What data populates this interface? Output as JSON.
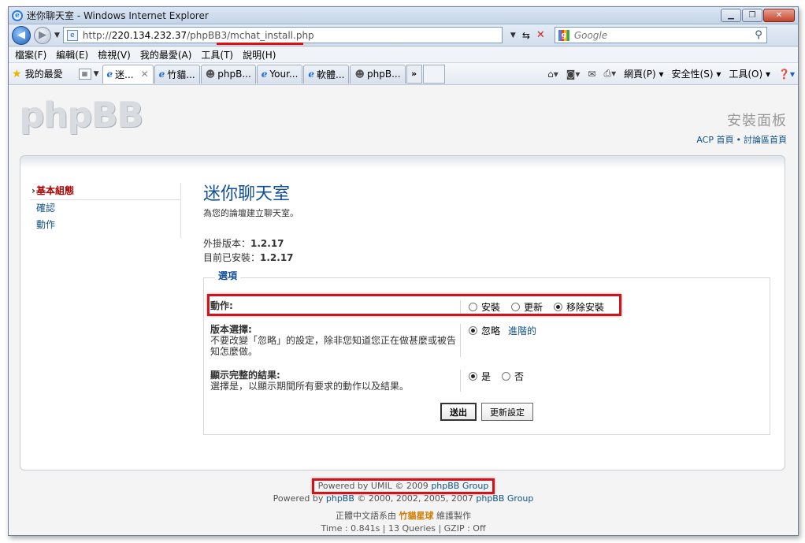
{
  "window": {
    "title": "迷你聊天室 - Windows Internet Explorer",
    "minimize": "▁",
    "restore": "❐",
    "close": "✕"
  },
  "address": {
    "url_prefix": "http://",
    "url_host": "220.134.232.37",
    "url_path": "/phpBB3/mchat_install.php",
    "search_placeholder": "Google"
  },
  "menu": [
    "檔案(F)",
    "編輯(E)",
    "檢視(V)",
    "我的最愛(A)",
    "工具(T)",
    "說明(H)"
  ],
  "favorites": {
    "label": "我的最愛",
    "tabs": [
      {
        "label": "迷...",
        "icon": "ie-icon",
        "active": true
      },
      {
        "label": "竹貓...",
        "icon": "ie-icon"
      },
      {
        "label": "phpB...",
        "icon": "people-icon"
      },
      {
        "label": "Your...",
        "icon": "ie-icon"
      },
      {
        "label": "軟體...",
        "icon": "ie-icon"
      },
      {
        "label": "phpB...",
        "icon": "people-icon"
      }
    ],
    "more": "»"
  },
  "commands": {
    "page": "網頁(P)",
    "safety": "安全性(S)",
    "tools": "工具(O)"
  },
  "header": {
    "logo": "phpBB",
    "panel_title": "安裝面板",
    "link_acp": "ACP 首頁",
    "link_forum": "討論區首頁"
  },
  "sidebar": {
    "items": [
      {
        "label": "基本組態",
        "active": true
      },
      {
        "label": "確認"
      },
      {
        "label": "動作"
      }
    ]
  },
  "main": {
    "title": "迷你聊天室",
    "description": "為您的論壇建立聊天室。",
    "mod_version_label": "外掛版本：",
    "mod_version": "1.2.17",
    "installed_label": "目前已安裝：",
    "installed_version": "1.2.17",
    "options_legend": "選項",
    "action": {
      "label": "動作:",
      "options": [
        "安裝",
        "更新",
        "移除安裝"
      ],
      "selected": 2
    },
    "version_select": {
      "label": "版本選擇:",
      "help": "不要改變「忽略」的設定，除非您知道您正在做甚麼或被告知怎麼做。",
      "options": [
        "忽略",
        "進階的"
      ],
      "selected": 0
    },
    "show_results": {
      "label": "顯示完整的結果:",
      "help": "選擇是，以顯示期間所有要求的動作以及結果。",
      "options": [
        "是",
        "否"
      ],
      "selected": 0
    },
    "submit": "送出",
    "reset": "更新設定"
  },
  "footer": {
    "umil_prefix": "Powered by UMIL © 2009",
    "umil_link": "phpBB Group",
    "phpbb_prefix": "Powered by",
    "phpbb_link1": "phpBB",
    "phpbb_mid": "© 2000, 2002, 2005, 2007",
    "phpbb_link2": "phpBB Group",
    "translation_prefix": "正體中文語系由",
    "translation_team": "竹貓星球",
    "translation_suffix": "維護製作",
    "stats": "Time : 0.841s | 13 Queries | GZIP : Off"
  }
}
